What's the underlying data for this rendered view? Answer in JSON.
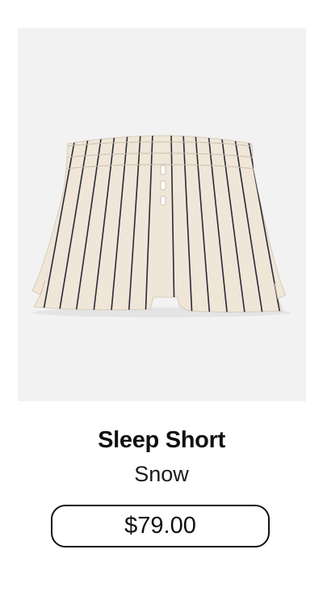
{
  "product": {
    "name": "Sleep Short",
    "color": "Snow",
    "price": "$79.00",
    "image_alt": "Sleep Short in Snow"
  },
  "colors": {
    "background": "#ffffff",
    "image_background": "#f2f2f2",
    "fabric": "#efe6d8",
    "stripe": "#2a2a35",
    "text": "#111111"
  }
}
